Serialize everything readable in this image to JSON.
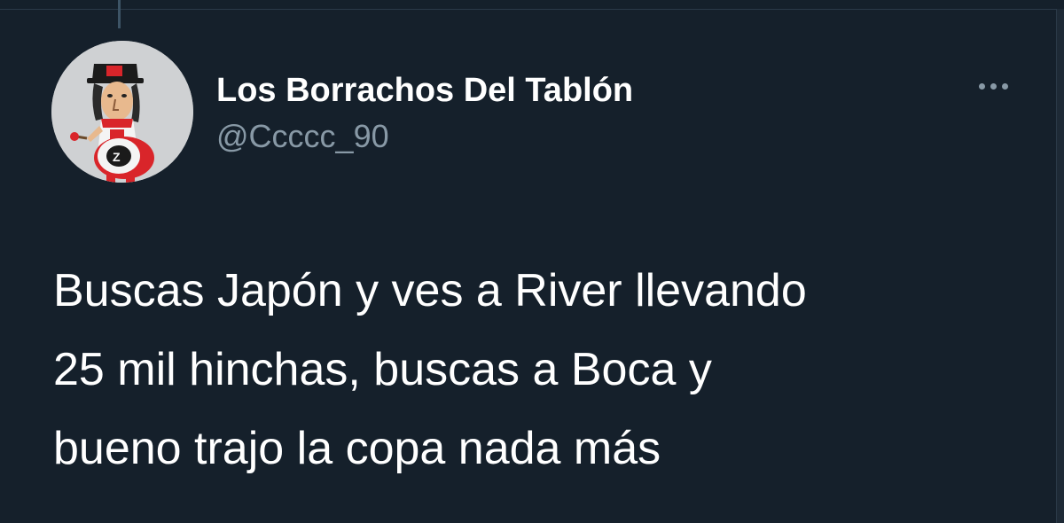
{
  "tweet": {
    "author": {
      "display_name": "Los Borrachos Del Tablón",
      "handle": "@Ccccc_90",
      "avatar_icon": "cartoon-drummer-avatar"
    },
    "text": "Buscas Japón y ves a River llevando\n25 mil hinchas, buscas a Boca y\nbueno trajo la copa nada más",
    "more_icon": "more-dots-icon"
  },
  "colors": {
    "background": "#15202b",
    "primary_text": "#ffffff",
    "secondary_text": "#8899a6"
  }
}
